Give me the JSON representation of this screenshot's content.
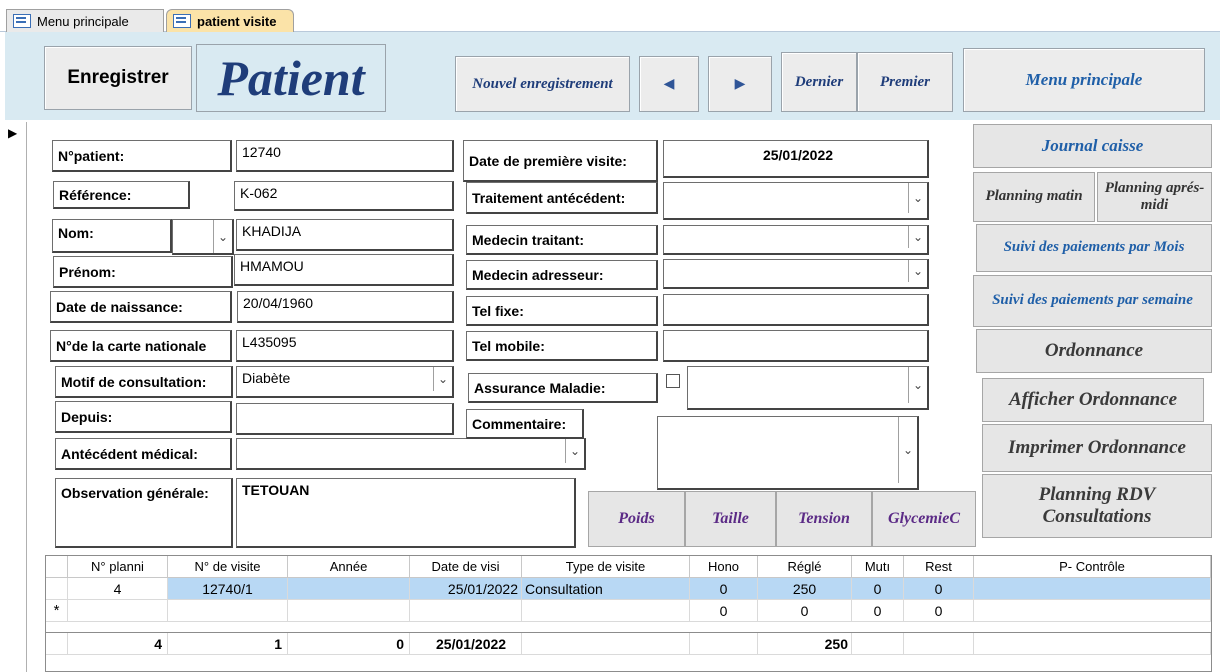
{
  "tabs": [
    {
      "label": "Menu principale",
      "active": false
    },
    {
      "label": "patient visite",
      "active": true
    }
  ],
  "header": {
    "save_label": "Enregistrer",
    "title": "Patient",
    "new_record_label": "Nouvel enregistrement",
    "prev_icon": "◀",
    "next_icon": "▶",
    "last_label": "Dernier",
    "first_label": "Premier",
    "main_menu_label": "Menu principale"
  },
  "record_selector": "▶",
  "form": {
    "num_patient": {
      "label": "N°patient:",
      "value": "12740"
    },
    "reference": {
      "label": "Référence:",
      "value": "K-062"
    },
    "nom": {
      "label": "Nom:",
      "value": "KHADIJA"
    },
    "prenom": {
      "label": "Prénom:",
      "value": "HMAMOU"
    },
    "date_naissance": {
      "label": "Date de naissance:",
      "value": "20/04/1960"
    },
    "carte_nationale": {
      "label": "N°de la carte nationale",
      "value": "L435095"
    },
    "motif": {
      "label": "Motif de consultation:",
      "value": "Diabète"
    },
    "depuis": {
      "label": "Depuis:",
      "value": ""
    },
    "antecedent": {
      "label": "Antécédent médical:",
      "value": ""
    },
    "observation": {
      "label": "Observation générale:",
      "value": "TETOUAN"
    },
    "date_premiere_visite": {
      "label": "Date de première visite:",
      "value": "25/01/2022"
    },
    "traitement": {
      "label": "Traitement antécédent:",
      "value": ""
    },
    "medecin_traitant": {
      "label": "Medecin traitant:",
      "value": ""
    },
    "medecin_adresseur": {
      "label": "Medecin adresseur:",
      "value": ""
    },
    "tel_fixe": {
      "label": "Tel fixe:",
      "value": ""
    },
    "tel_mobile": {
      "label": "Tel mobile:",
      "value": ""
    },
    "assurance": {
      "label": "Assurance Maladie:",
      "value": ""
    },
    "commentaire": {
      "label": "Commentaire:",
      "value": ""
    }
  },
  "measure_buttons": [
    "Poids",
    "Taille",
    "Tension",
    "GlycemieC"
  ],
  "side_buttons": {
    "journal": "Journal caisse",
    "planning_matin": "Planning matin",
    "planning_apres_midi": "Planning aprés-midi",
    "suivi_mois": "Suivi des paiements par Mois",
    "suivi_semaine": "Suivi des paiements par semaine",
    "ordonnance": "Ordonnance",
    "afficher_ordonnance": "Afficher Ordonnance",
    "imprimer_ordonnance": "Imprimer Ordonnance",
    "planning_rdv": "Planning RDV Consultations"
  },
  "grid": {
    "headers": [
      "N° planni",
      "N° de visite",
      "Année",
      "Date de visi",
      "Type de visite",
      "Hono",
      "Réglé",
      "Mutı",
      "Rest",
      "P- Contrôle"
    ],
    "row1": [
      "4",
      "12740/1",
      "",
      "25/01/2022",
      "Consultation",
      "0",
      "250",
      "0",
      "0",
      ""
    ],
    "new_row_marker": "*",
    "row2": [
      "",
      "",
      "",
      "",
      "",
      "0",
      "0",
      "0",
      "0",
      ""
    ],
    "totals": [
      "4",
      "1",
      "0",
      "25/01/2022",
      "",
      "",
      "250",
      "",
      "",
      ""
    ],
    "selected_color": "#b8d8f4"
  },
  "colors": {
    "header_band": "#d9eaf2",
    "title_blue": "#1f3d7a",
    "link_blue": "#1f5fa8",
    "measure_purple": "#5b2a86",
    "active_tab": "#fbe3a8"
  }
}
